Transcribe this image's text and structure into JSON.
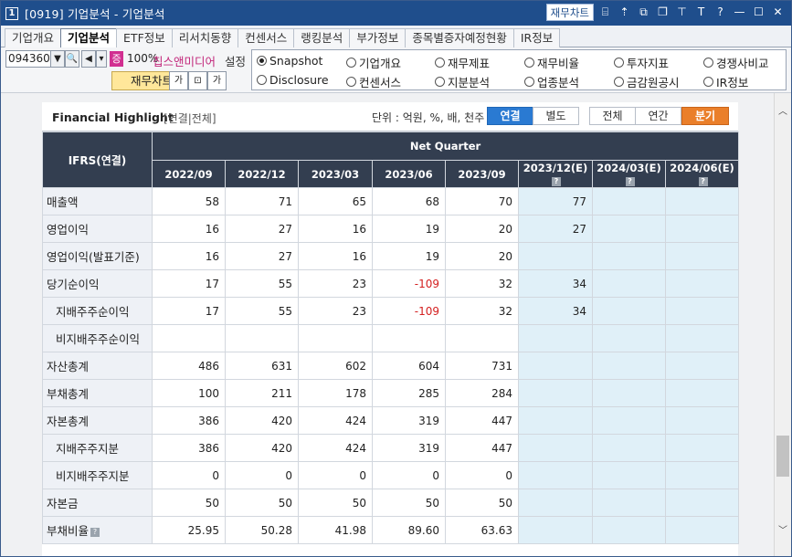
{
  "window": {
    "number": "1",
    "title": "[0919] 기업분석 - 기업분석",
    "fin_chart_label": "재무차트",
    "icons": [
      "chart-icon",
      "arrow-up-icon",
      "window-copy-icon",
      "window-restore-icon",
      "pin-icon",
      "text-icon",
      "help-icon",
      "minimize-icon",
      "maximize-icon",
      "close-icon"
    ],
    "glyphs": {
      "chart": "⌸",
      "up": "⇡",
      "copy": "⧉",
      "restore": "❐",
      "pin": "⊤",
      "text": "T",
      "help": "?",
      "min": "—",
      "max": "☐",
      "close": "✕"
    }
  },
  "tabs": [
    {
      "label": "기업개요",
      "active": false
    },
    {
      "label": "기업분석",
      "active": true
    },
    {
      "label": "ETF정보",
      "active": false
    },
    {
      "label": "리서치동향",
      "active": false
    },
    {
      "label": "컨센서스",
      "active": false
    },
    {
      "label": "랭킹분석",
      "active": false
    },
    {
      "label": "부가정보",
      "active": false
    },
    {
      "label": "종목별증자예정현황",
      "active": false
    },
    {
      "label": "IR정보",
      "active": false
    }
  ],
  "controls": {
    "stock_code": "094360",
    "jeung": "증",
    "margin_pct": "100%",
    "company_name": "칩스앤미디어",
    "setting_label": "설정",
    "fin_chart_label": "재무차트",
    "ga_label": "가",
    "expand_label": "⊡",
    "ga2_label": "가",
    "radios": [
      {
        "label": "Snapshot",
        "checked": true
      },
      {
        "label": "기업개요",
        "checked": false
      },
      {
        "label": "재무제표",
        "checked": false
      },
      {
        "label": "재무비율",
        "checked": false
      },
      {
        "label": "투자지표",
        "checked": false
      },
      {
        "label": "경쟁사비교",
        "checked": false
      },
      {
        "label": "Disclosure",
        "checked": false
      },
      {
        "label": "컨센서스",
        "checked": false
      },
      {
        "label": "지분분석",
        "checked": false
      },
      {
        "label": "업종분석",
        "checked": false
      },
      {
        "label": "금감원공시",
        "checked": false
      },
      {
        "label": "IR정보",
        "checked": false
      }
    ]
  },
  "highlight": {
    "title": "Financial Highlight",
    "subtitle": "[연결|전체]",
    "unit": "단위 : 억원, %, 배, 천주",
    "consolidated_label": "연결",
    "separate_label": "별도",
    "all_label": "전체",
    "annual_label": "연간",
    "quarter_label": "분기"
  },
  "table": {
    "corner_header": "IFRS(연결)",
    "group_header": "Net Quarter",
    "periods": [
      "2022/09",
      "2022/12",
      "2023/03",
      "2023/06",
      "2023/09",
      "2023/12(E)",
      "2024/03(E)",
      "2024/06(E)"
    ],
    "rows": [
      {
        "label": "매출액",
        "indent": false,
        "values": [
          "58",
          "71",
          "65",
          "68",
          "70",
          "77",
          "",
          ""
        ]
      },
      {
        "label": "영업이익",
        "indent": false,
        "values": [
          "16",
          "27",
          "16",
          "19",
          "20",
          "27",
          "",
          ""
        ]
      },
      {
        "label": "영업이익(발표기준)",
        "indent": false,
        "values": [
          "16",
          "27",
          "16",
          "19",
          "20",
          "",
          "",
          ""
        ]
      },
      {
        "label": "당기순이익",
        "indent": false,
        "values": [
          "17",
          "55",
          "23",
          "-109",
          "32",
          "34",
          "",
          ""
        ]
      },
      {
        "label": "지배주주순이익",
        "indent": true,
        "values": [
          "17",
          "55",
          "23",
          "-109",
          "32",
          "34",
          "",
          ""
        ]
      },
      {
        "label": "비지배주주순이익",
        "indent": true,
        "values": [
          "",
          "",
          "",
          "",
          "",
          "",
          "",
          ""
        ]
      },
      {
        "label": "자산총계",
        "indent": false,
        "values": [
          "486",
          "631",
          "602",
          "604",
          "731",
          "",
          "",
          ""
        ]
      },
      {
        "label": "부채총계",
        "indent": false,
        "values": [
          "100",
          "211",
          "178",
          "285",
          "284",
          "",
          "",
          ""
        ]
      },
      {
        "label": "자본총계",
        "indent": false,
        "values": [
          "386",
          "420",
          "424",
          "319",
          "447",
          "",
          "",
          ""
        ]
      },
      {
        "label": "지배주주지분",
        "indent": true,
        "values": [
          "386",
          "420",
          "424",
          "319",
          "447",
          "",
          "",
          ""
        ]
      },
      {
        "label": "비지배주주지분",
        "indent": true,
        "values": [
          "0",
          "0",
          "0",
          "0",
          "0",
          "",
          "",
          ""
        ]
      },
      {
        "label": "자본금",
        "indent": false,
        "values": [
          "50",
          "50",
          "50",
          "50",
          "50",
          "",
          "",
          ""
        ]
      },
      {
        "label": "부채비율",
        "indent": false,
        "help": true,
        "values": [
          "25.95",
          "50.28",
          "41.98",
          "89.60",
          "63.63",
          "",
          "",
          ""
        ]
      }
    ]
  },
  "scrollbar": {
    "up": "︿",
    "down": "﹀"
  }
}
